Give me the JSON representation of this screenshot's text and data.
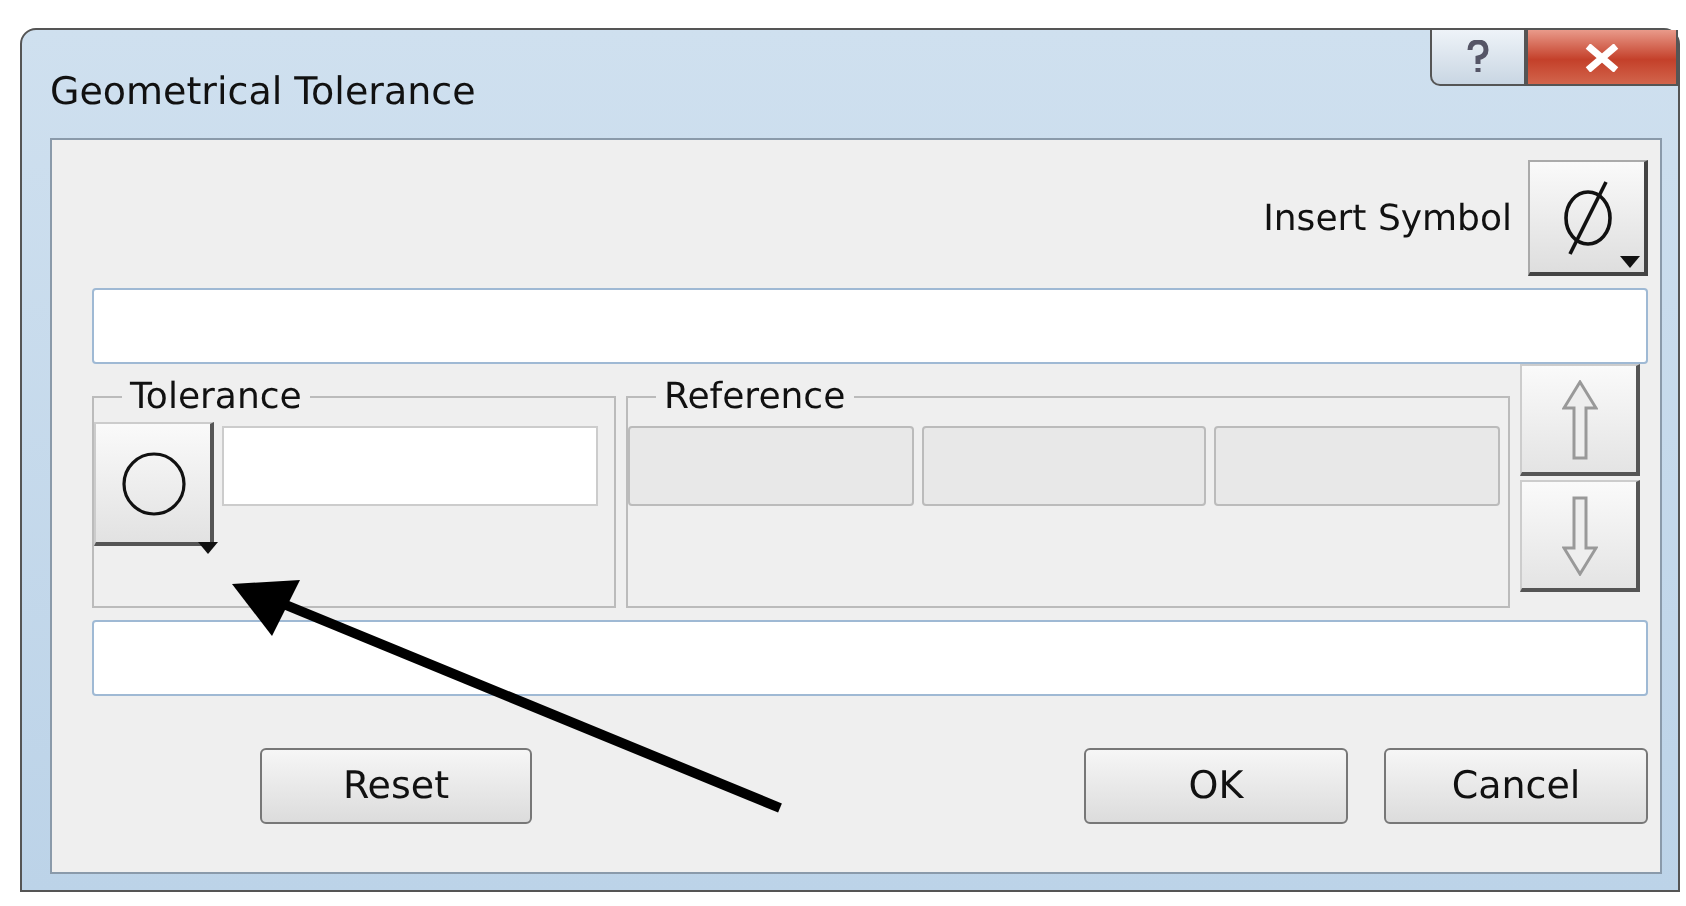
{
  "window": {
    "title": "Geometrical Tolerance"
  },
  "insert_symbol": {
    "label": "Insert Symbol"
  },
  "tolerance": {
    "title": "Tolerance"
  },
  "reference": {
    "title": "Reference",
    "fields": [
      {
        "disabled": true
      },
      {
        "disabled": true
      },
      {
        "disabled": true
      }
    ]
  },
  "buttons": [
    {
      "label": "Reset",
      "kind": "left"
    },
    {
      "label": "OK",
      "kind": "right"
    },
    {
      "label": "Cancel",
      "kind": "right"
    }
  ]
}
